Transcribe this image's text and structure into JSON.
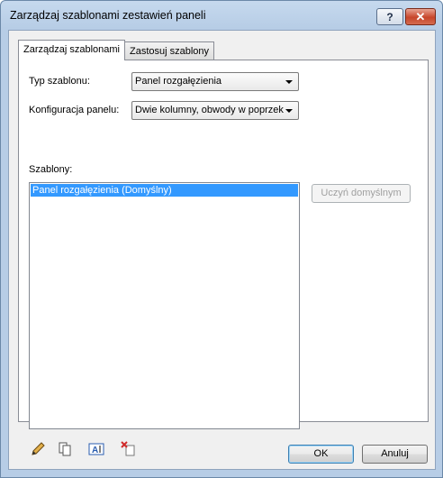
{
  "window": {
    "title": "Zarządzaj szablonami zestawień paneli",
    "help_label": "?",
    "close_label": "✕"
  },
  "tabs": [
    {
      "label": "Zarządzaj szablonami",
      "active": true
    },
    {
      "label": "Zastosuj szablony",
      "active": false
    }
  ],
  "form": {
    "template_type_label": "Typ szablonu:",
    "template_type_value": "Panel rozgałęzienia",
    "panel_config_label": "Konfiguracja panelu:",
    "panel_config_value": "Dwie kolumny, obwody w poprzek",
    "templates_label": "Szablony:"
  },
  "templates": [
    {
      "label": "Panel rozgałęzienia (Domyślny)",
      "selected": true
    }
  ],
  "buttons": {
    "set_default": "Uczyń domyślnym",
    "ok": "OK",
    "cancel": "Anuluj"
  },
  "icons": [
    "edit-pencil-icon",
    "duplicate-icon",
    "rename-icon",
    "delete-icon"
  ]
}
